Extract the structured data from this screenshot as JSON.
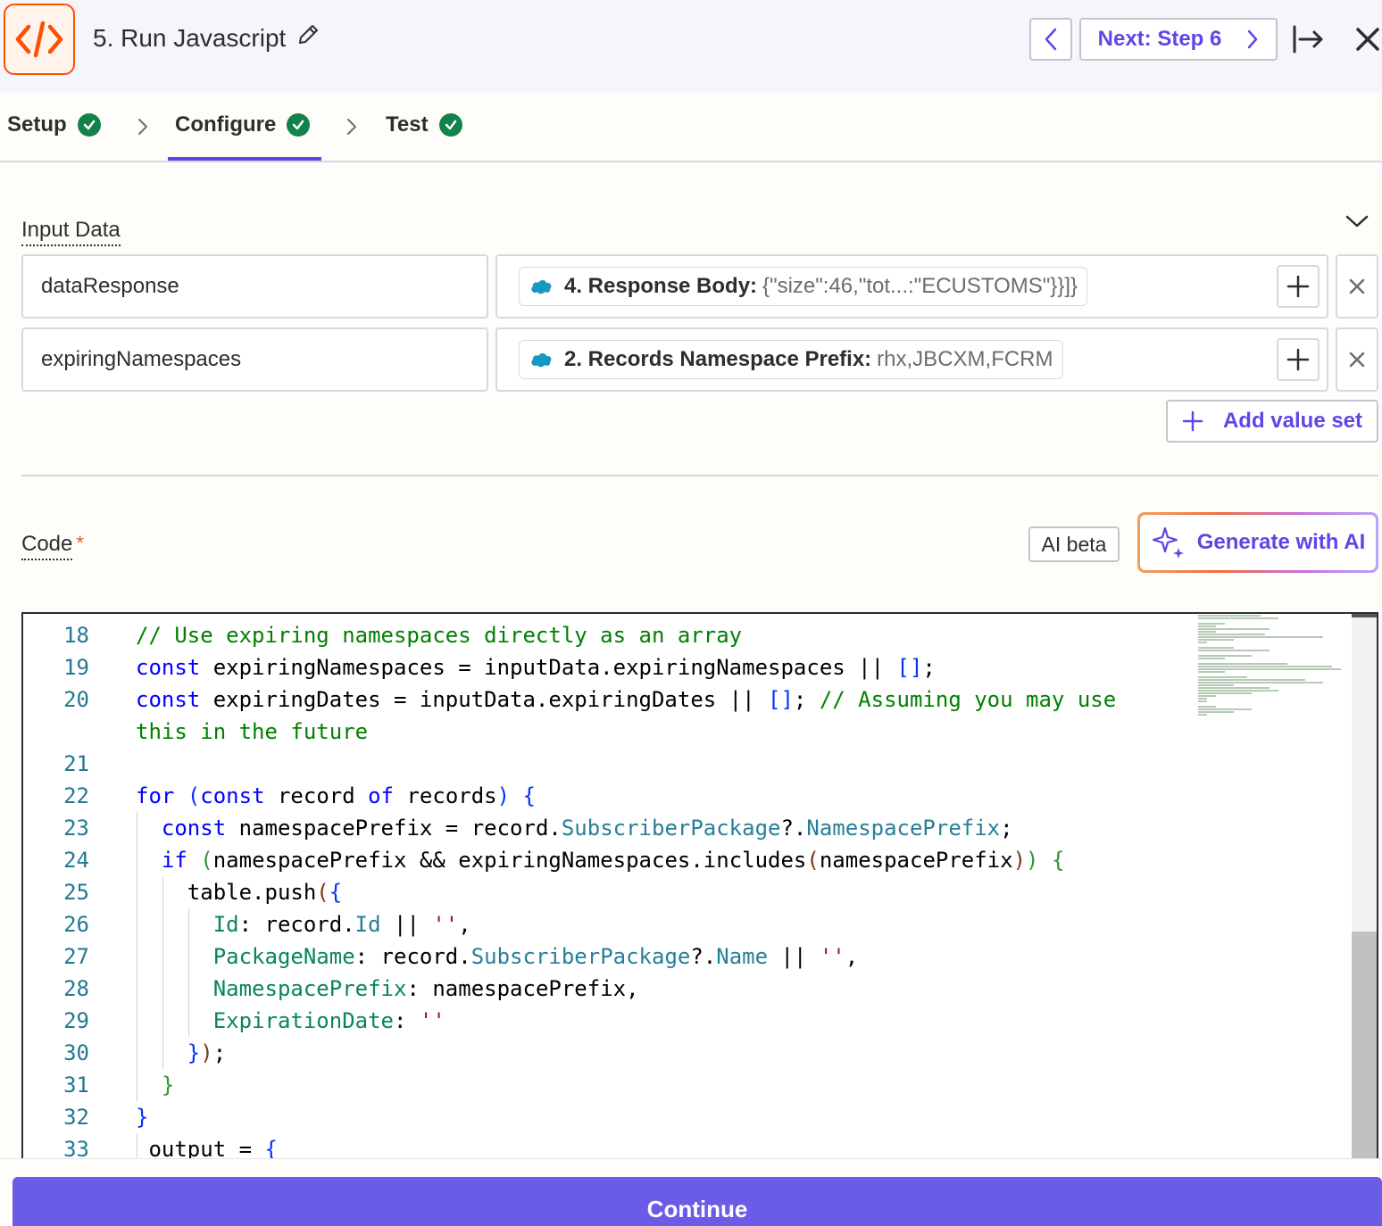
{
  "header": {
    "step_title": "5. Run Javascript",
    "next_label": "Next: Step 6"
  },
  "tabs": [
    {
      "label": "Setup",
      "complete": true
    },
    {
      "label": "Configure",
      "complete": true,
      "active": true
    },
    {
      "label": "Test",
      "complete": true
    }
  ],
  "input_data": {
    "label": "Input Data",
    "rows": [
      {
        "key": "dataResponse",
        "pill_key": "4. Response Body:",
        "pill_value": "{\"size\":46,\"tot...:\"ECUSTOMS\"}}]}"
      },
      {
        "key": "expiringNamespaces",
        "pill_key": "2. Records Namespace Prefix:",
        "pill_value": "rhx,JBCXM,FCRM"
      }
    ],
    "add_value_set_label": "Add value set"
  },
  "code": {
    "label": "Code",
    "required_mark": "*",
    "ai_badge": "AI beta",
    "generate_label": "Generate with AI",
    "line_numbers": [
      "18",
      "19",
      "20",
      "",
      "21",
      "22",
      "23",
      "24",
      "25",
      "26",
      "27",
      "28",
      "29",
      "30",
      "31",
      "32",
      "33"
    ]
  },
  "footer": {
    "continue_label": "Continue"
  },
  "colors": {
    "accent": "#5e47e5",
    "continue_bg": "#6b5ce7",
    "success": "#12824a",
    "brand_orange": "#ff4f00"
  }
}
